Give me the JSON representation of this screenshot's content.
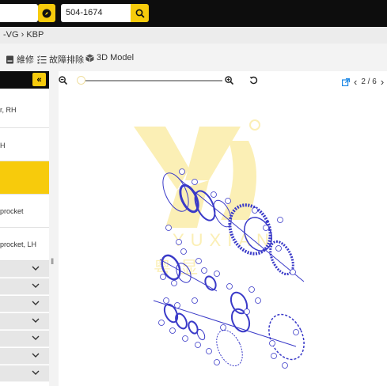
{
  "search": {
    "part_value": "504-1674"
  },
  "breadcrumb": {
    "text": "-VG › KBP"
  },
  "toolbar": {
    "repair_label": "維修",
    "troubleshoot_label": "故障排除",
    "model3d_label": "3D Model"
  },
  "sidebar": {
    "items": [
      {
        "label": "r, RH"
      },
      {
        "label": "H"
      },
      {
        "label": ""
      },
      {
        "label": "procket"
      },
      {
        "label": "procket, LH"
      }
    ],
    "collapsed_rows": 7
  },
  "viewer": {
    "zoom_level": 0.03,
    "page_indicator": "2 / 6"
  },
  "watermark": {
    "text": "YUXIAN",
    "cjk": "粤显"
  },
  "colors": {
    "accent": "#f7cb0c",
    "topbar": "#0d0d0d",
    "diagram_line": "#3a3ac8",
    "link_blue": "#1e88e5"
  },
  "icons": {
    "compass": "compass-icon",
    "search": "search-icon",
    "book": "book-icon",
    "checklist": "checklist-icon",
    "cube": "cube-icon",
    "zoom_out": "zoom-out-icon",
    "zoom_in": "zoom-in-icon",
    "reset": "rotate-left-icon",
    "external": "external-link-icon",
    "prev": "chevron-left-icon",
    "next": "chevron-right-icon",
    "collapse": "double-chevron-left-icon",
    "expand": "chevron-down-icon"
  }
}
